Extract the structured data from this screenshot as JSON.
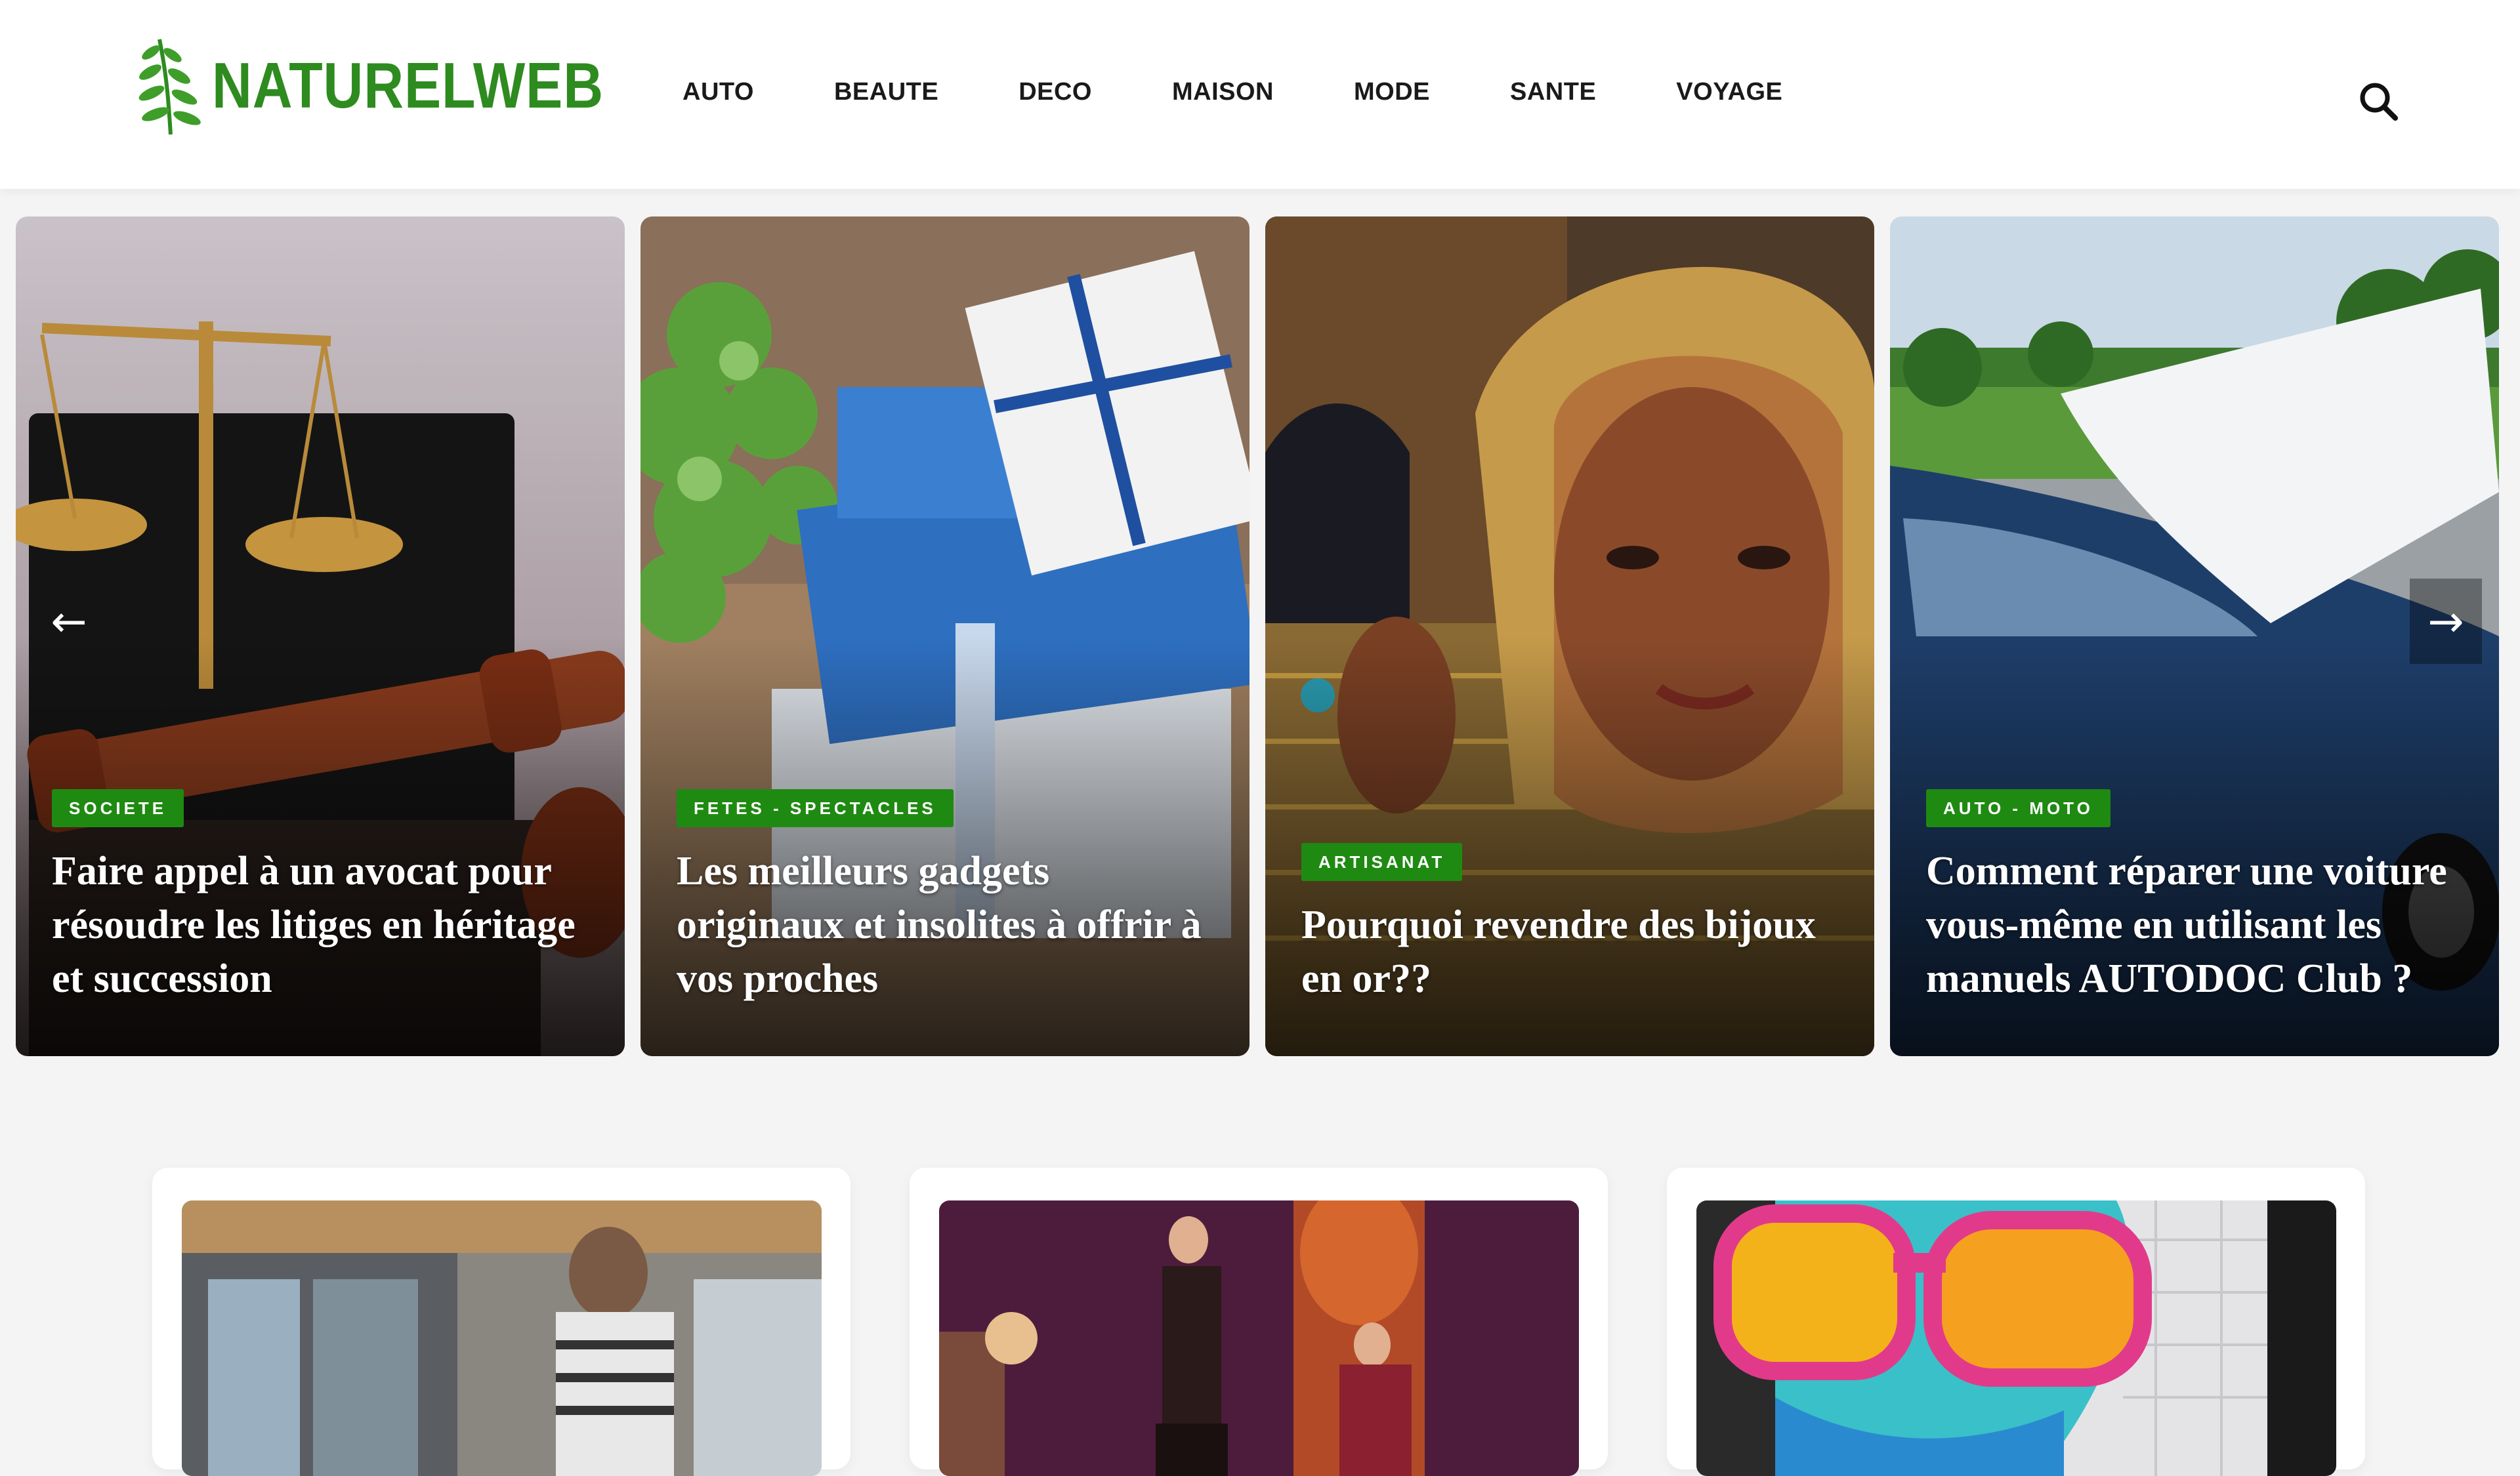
{
  "site": {
    "logo_text": "NATURELWEB",
    "brand_color": "#2e8b1f"
  },
  "nav": {
    "items": [
      "AUTO",
      "BEAUTE",
      "DECO",
      "MAISON",
      "MODE",
      "SANTE",
      "VOYAGE"
    ]
  },
  "header": {
    "search_icon": "search-icon"
  },
  "slider": {
    "prev_icon": "arrow-left-icon",
    "next_icon": "arrow-right-icon",
    "category_color": "#1f8a12",
    "slides": [
      {
        "category": "SOCIETE",
        "title": "Faire appel à un avocat pour résoudre les litiges en héritage et succession"
      },
      {
        "category": "FETES - SPECTACLES",
        "title": "Les meilleurs gadgets originaux et insolites à offrir à vos proches"
      },
      {
        "category": "ARTISANAT",
        "title": "Pourquoi revendre des bijoux en or??"
      },
      {
        "category": "AUTO - MOTO",
        "title": "Comment réparer une voiture vous-même en utilisant les manuels AUTODOC Club ?"
      }
    ]
  }
}
